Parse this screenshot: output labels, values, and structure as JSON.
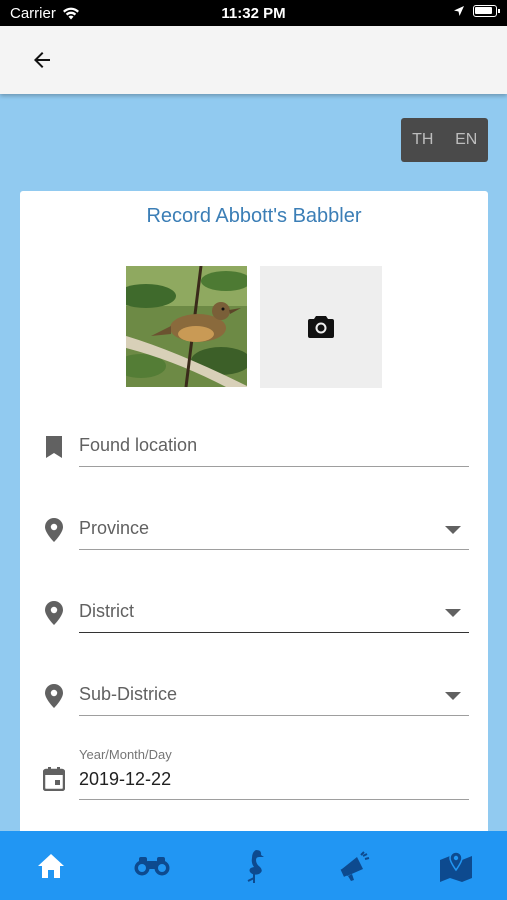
{
  "status_bar": {
    "carrier": "Carrier",
    "time": "11:32 PM"
  },
  "icons": {
    "back": "arrow-left-icon",
    "camera": "camera-icon",
    "bookmark": "bookmark-icon",
    "location": "location-pin-icon",
    "calendar": "calendar-icon",
    "home": "home-icon",
    "binoculars": "binoculars-icon",
    "flamingo": "flamingo-icon",
    "megaphone": "megaphone-icon",
    "map": "map-icon"
  },
  "language": {
    "th": "TH",
    "en": "EN"
  },
  "form": {
    "title": "Record Abbott's Babbler",
    "found_location": "Found location",
    "province": "Province",
    "district": "District",
    "sub_district": "Sub-Districe",
    "date_label": "Year/Month/Day",
    "date_value": "2019-12-22"
  },
  "colors": {
    "background": "#91caf0",
    "accent": "#2196f3",
    "title": "#3b7eb6",
    "nav_icon_active": "#ffffff",
    "nav_icon": "#0d4a8f"
  }
}
